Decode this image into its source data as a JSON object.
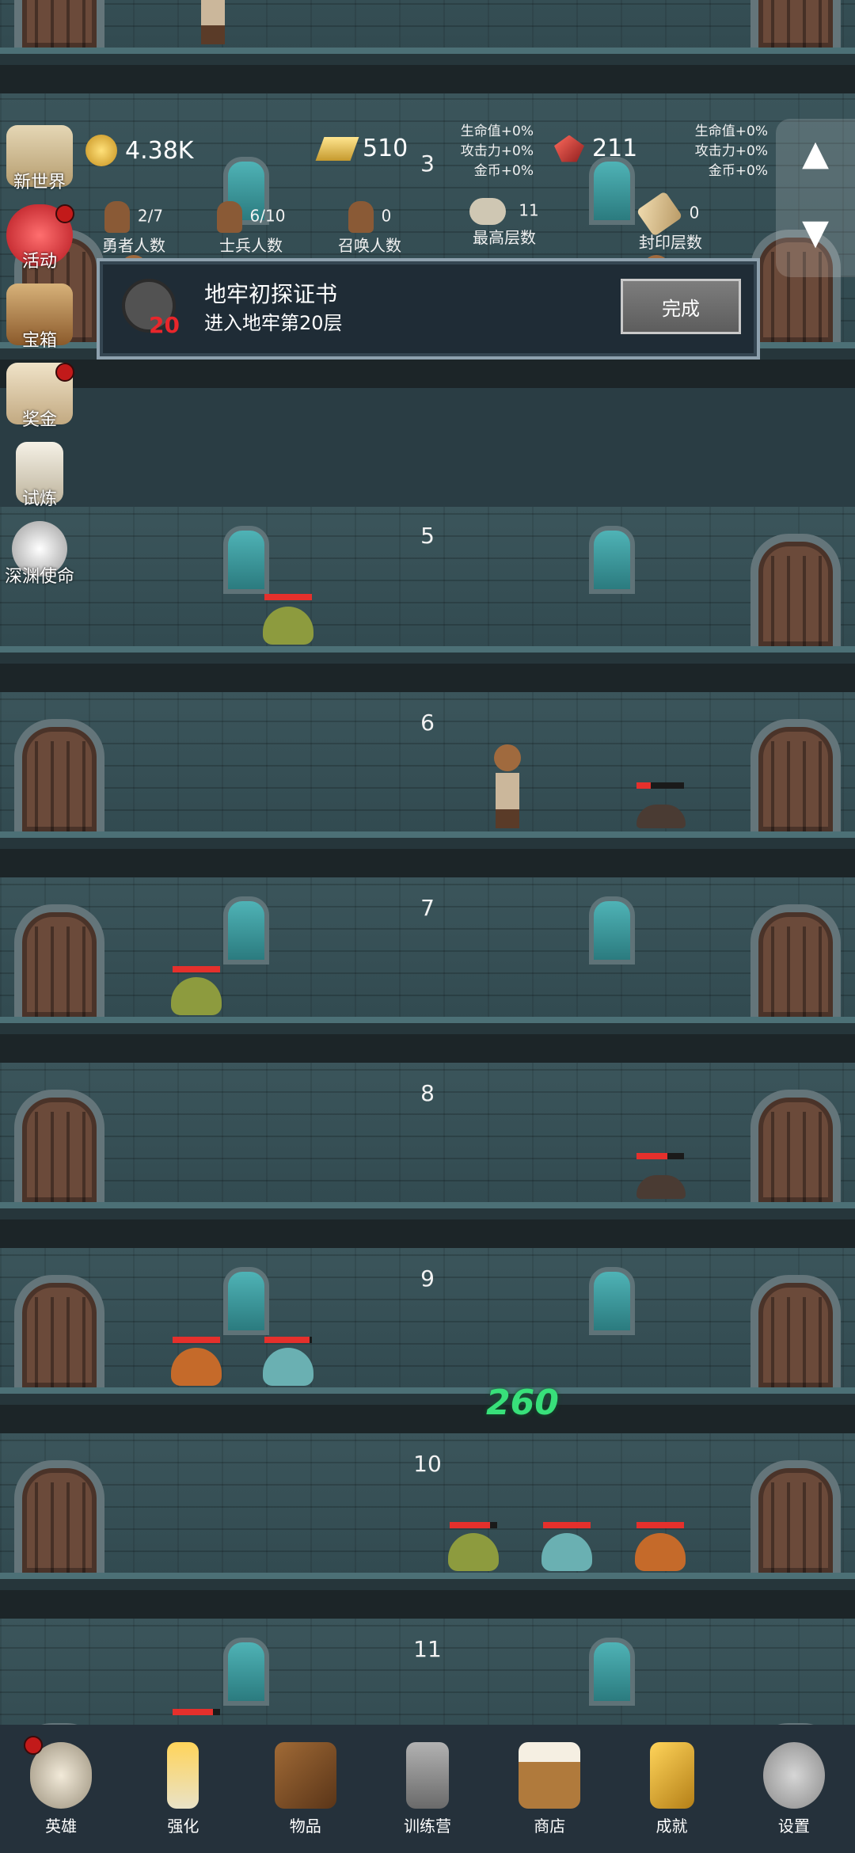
{
  "hud": {
    "gold": "4.38K",
    "bars": "510",
    "gems": "211",
    "bonus_left": [
      "生命值+0%",
      "攻击力+0%",
      "金币+0%"
    ],
    "bonus_right": [
      "生命值+0%",
      "攻击力+0%",
      "金币+0%"
    ],
    "stats": {
      "heroes": {
        "value": "2/7",
        "label": "勇者人数"
      },
      "soldiers": {
        "value": "6/10",
        "label": "士兵人数"
      },
      "summons": {
        "value": "0",
        "label": "召唤人数"
      },
      "max_floor": {
        "value": "11",
        "label": "最高层数"
      },
      "sealed": {
        "value": "0",
        "label": "封印层数"
      }
    }
  },
  "quest": {
    "title": "地牢初探证书",
    "desc": "进入地牢第20层",
    "badge": "20",
    "button": "完成"
  },
  "side_menu": [
    "新世界",
    "活动",
    "宝箱",
    "奖金",
    "试炼",
    "深渊使命"
  ],
  "floors": [
    "3",
    "5",
    "6",
    "7",
    "8",
    "9",
    "10",
    "11"
  ],
  "damage_text": "260",
  "nav": [
    "英雄",
    "强化",
    "物品",
    "训练营",
    "商店",
    "成就",
    "设置"
  ],
  "colors": {
    "accent_red": "#e5302c",
    "damage_green": "#38e07a",
    "nav_bg": "#25313b"
  },
  "icons": {
    "up": "▲",
    "down": "▼"
  }
}
